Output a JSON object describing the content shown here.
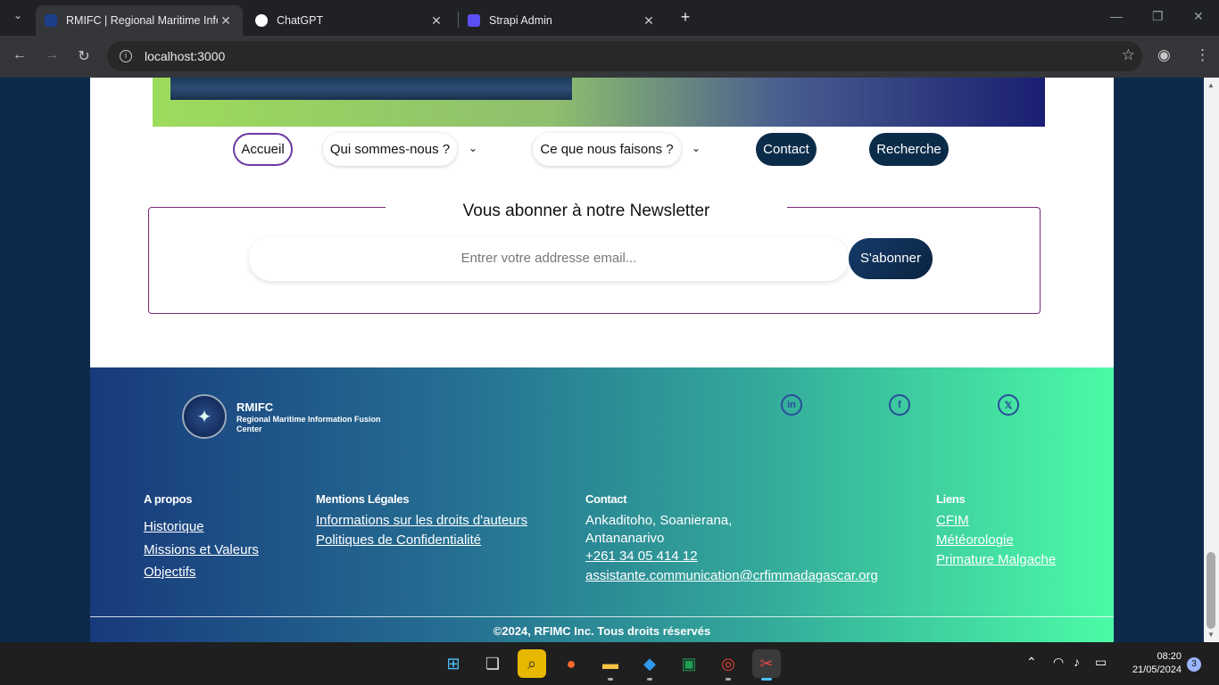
{
  "browser": {
    "tabs": [
      {
        "title": "RMIFC | Regional Maritime Information Fusion Center",
        "active": true
      },
      {
        "title": "ChatGPT",
        "active": false
      },
      {
        "title": "Strapi Admin",
        "active": false
      }
    ],
    "url": "localhost:3000"
  },
  "nav": {
    "home": "Accueil",
    "about": "Qui sommes-nous ?",
    "work": "Ce que nous faisons ?",
    "contact": "Contact",
    "search": "Recherche"
  },
  "newsletter": {
    "title": "Vous abonner à notre Newsletter",
    "placeholder": "Entrer votre addresse email...",
    "button": "S'abonner"
  },
  "footer": {
    "logo_name": "RMIFC",
    "logo_sub": "Regional Maritime Information Fusion Center",
    "social": [
      "linkedin-icon",
      "facebook-icon",
      "x-twitter-icon"
    ],
    "apropos": {
      "title": "A propos",
      "links": [
        "Historique",
        "Missions et Valeurs",
        "Objectifs"
      ]
    },
    "mentions": {
      "title": "Mentions Légales",
      "links": [
        "Informations sur les droits d'auteurs",
        "Politiques de Confidentialité"
      ]
    },
    "contact": {
      "title": "Contact",
      "address1": "Ankaditoho, Soanierana,",
      "address2": "Antananarivo",
      "phone": "+261 34 05 414 12",
      "email": "assistante.communication@crfimmadagascar.org"
    },
    "liens": {
      "title": "Liens",
      "links": [
        "CFIM",
        "Météorologie",
        "Primature Malgache"
      ]
    },
    "copyright": "©2024, RFIMC Inc. Tous droits réservés"
  },
  "taskbar": {
    "time": "08:20",
    "date": "21/05/2024",
    "notifications": "3"
  }
}
